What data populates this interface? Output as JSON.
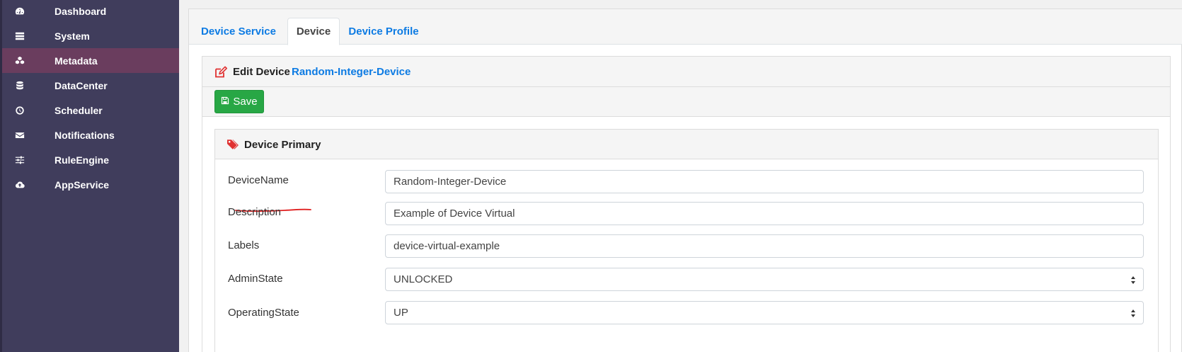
{
  "sidebar": {
    "items": [
      {
        "label": "Dashboard",
        "icon": "dashboard-icon",
        "active": false
      },
      {
        "label": "System",
        "icon": "server-icon",
        "active": false
      },
      {
        "label": "Metadata",
        "icon": "cubes-icon",
        "active": true
      },
      {
        "label": "DataCenter",
        "icon": "database-icon",
        "active": false
      },
      {
        "label": "Scheduler",
        "icon": "clock-icon",
        "active": false
      },
      {
        "label": "Notifications",
        "icon": "envelope-icon",
        "active": false
      },
      {
        "label": "RuleEngine",
        "icon": "sliders-icon",
        "active": false
      },
      {
        "label": "AppService",
        "icon": "cloud-upload-icon",
        "active": false
      }
    ]
  },
  "tabs": [
    {
      "label": "Device Service",
      "active": false
    },
    {
      "label": "Device",
      "active": true
    },
    {
      "label": "Device Profile",
      "active": false
    }
  ],
  "edit": {
    "title": "Edit Device",
    "device_name": "Random-Integer-Device",
    "save_label": "Save"
  },
  "primary": {
    "title": "Device Primary",
    "fields": {
      "device_name": {
        "label": "DeviceName",
        "value": "Random-Integer-Device"
      },
      "description": {
        "label": "Description",
        "value": "Example of Device Virtual"
      },
      "labels": {
        "label": "Labels",
        "value": "device-virtual-example"
      },
      "admin_state": {
        "label": "AdminState",
        "value": "UNLOCKED"
      },
      "operating_state": {
        "label": "OperatingState",
        "value": "UP"
      }
    }
  },
  "colors": {
    "sidebar_bg": "#403d5c",
    "sidebar_active": "#6a3d5e",
    "link_blue": "#0d7be3",
    "save_green": "#28a745",
    "edit_icon_red": "#e03131",
    "annotation_red": "#e02020"
  }
}
